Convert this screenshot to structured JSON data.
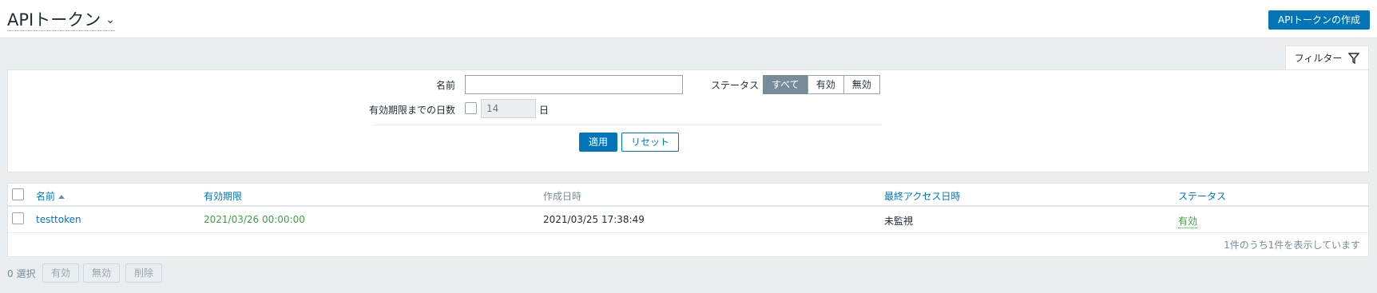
{
  "header": {
    "title": "APIトークン",
    "create_button": "APIトークンの作成"
  },
  "filter": {
    "tab_label": "フィルター",
    "name_label": "名前",
    "name_value": "",
    "days_label": "有効期限までの日数",
    "days_placeholder": "14",
    "days_unit": "日",
    "status_label": "ステータス",
    "status_options": [
      "すべて",
      "有効",
      "無効"
    ],
    "status_selected": "すべて",
    "apply_button": "適用",
    "reset_button": "リセット"
  },
  "table": {
    "columns": [
      "名前",
      "有効期限",
      "作成日時",
      "最終アクセス日時",
      "ステータス"
    ],
    "sorted_column": "名前",
    "rows": [
      {
        "name": "testtoken",
        "expires": "2021/03/26 00:00:00",
        "created": "2021/03/25 17:38:49",
        "last_access": "未監視",
        "status": "有効"
      }
    ],
    "paging_text": "1件のうち1件を表示しています"
  },
  "footer": {
    "selected_text": "0 選択",
    "actions": [
      "有効",
      "無効",
      "削除"
    ]
  },
  "colors": {
    "accent": "#0275b8",
    "active_status": "#429e47",
    "segment_active": "#768d99",
    "background": "#ebeef0"
  }
}
